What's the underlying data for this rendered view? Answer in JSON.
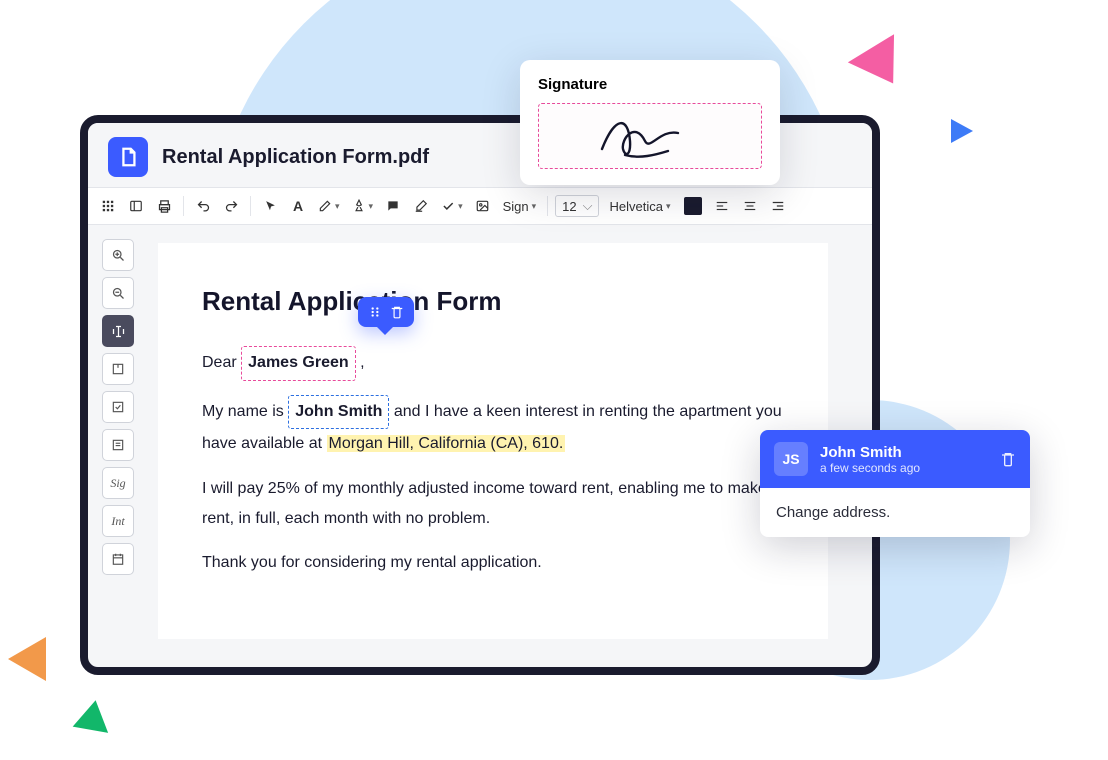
{
  "file": {
    "title": "Rental Application Form.pdf"
  },
  "toolbar": {
    "sign_label": "Sign",
    "font_size": "12",
    "font_family": "Helvetica"
  },
  "document": {
    "heading": "Rental Application Form",
    "salutation_prefix": "Dear",
    "recipient_name": "James Green",
    "salutation_suffix": ",",
    "para1_a": "My name is",
    "sender_name": "John Smith",
    "para1_b": "and I have a keen interest in renting the apartment you have available at",
    "address": "Morgan Hill, California (CA), 610.",
    "para2": "I will pay 25% of my monthly adjusted income toward rent, enabling me to make rent, in full, each month with no problem.",
    "para3": "Thank you for considering my rental application."
  },
  "signature": {
    "label": "Signature"
  },
  "comment": {
    "initials": "JS",
    "author": "John Smith",
    "time": "a few seconds ago",
    "text": "Change address."
  },
  "sidebar": {
    "sig_label": "Sig",
    "int_label": "Int"
  }
}
